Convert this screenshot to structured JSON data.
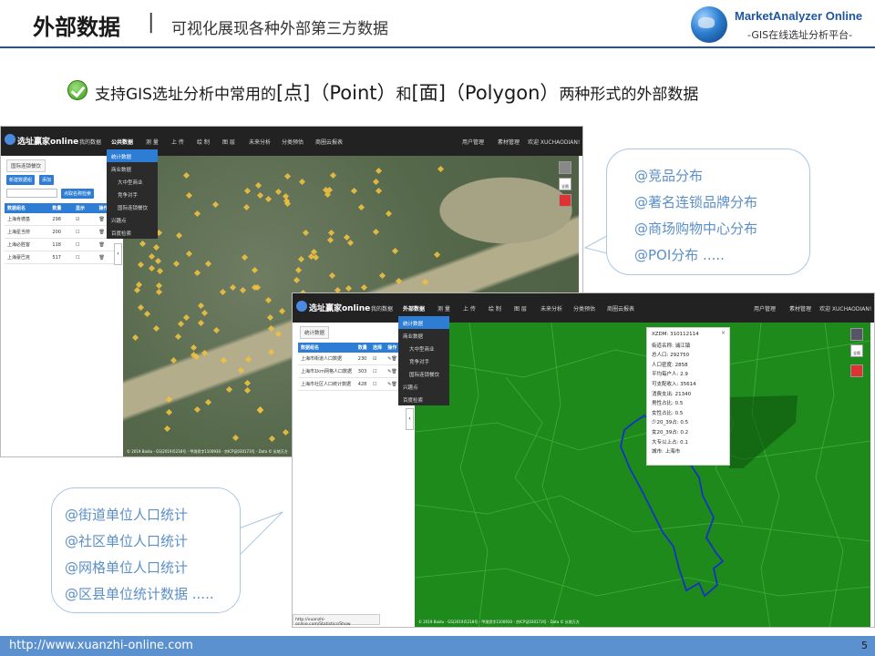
{
  "header": {
    "title": "外部数据",
    "separator": "|",
    "subtitle": "可视化展现各种外部第三方数据",
    "logo_name": "MarketAnalyzer Online",
    "logo_tagline": "-GIS在线选址分析平台-"
  },
  "lead": {
    "icon": "check-icon",
    "part1": "支持GIS选址分析中常用的",
    "point_cn": "[点]",
    "point_en": "（Point）",
    "and": "和",
    "polygon_cn": "[面]",
    "polygon_en": "（Polygon）",
    "part2": "两种形式的外部数据"
  },
  "app1": {
    "brand": "选址赢家online",
    "menu": [
      "我的数据",
      "公共数据",
      "测 量",
      "上 传",
      "绘 制",
      "图 层",
      "未来分析",
      "分类预估",
      "商圈云报表"
    ],
    "active_menu": "公共数据",
    "right_menu": [
      "用户管理",
      "素材管理",
      "欢迎 XUCHAODIAN!"
    ],
    "dropdown": [
      "统计数据",
      "商业数据",
      "大中型商业",
      "竞争对手",
      "国际连锁餐饮",
      "兴趣点",
      "百度检索"
    ],
    "tab": "国际连锁餐饮",
    "buttons": [
      "新建数据组",
      "添加"
    ],
    "search_button": "点取名称检索",
    "table_headers": [
      "数据组名",
      "数量",
      "显示",
      "操作"
    ],
    "rows": [
      {
        "name": "上海肯德基",
        "count": "298"
      },
      {
        "name": "上海星当劳",
        "count": "200"
      },
      {
        "name": "上海必胜客",
        "count": "118"
      },
      {
        "name": "上海豪巴克",
        "count": "517"
      }
    ],
    "map_note": "© 2019 Baidu - GS(2019)5218号 - 甲测资字1100930 - 京ICP证030173号 - Data © 长地万方",
    "map_controls": [
      "layers-icon",
      "locate-icon",
      "poi-icon"
    ],
    "map_ctrl_label": "全图"
  },
  "app2": {
    "brand": "选址赢家online",
    "menu": [
      "我的数据",
      "外部数据",
      "测 量",
      "上 传",
      "绘 制",
      "图 层",
      "未来分析",
      "分类预估",
      "商圈云报表"
    ],
    "active_menu": "外部数据",
    "right_menu": [
      "用户管理",
      "素材管理",
      "欢迎 XUCHAODIAN!"
    ],
    "dropdown": [
      "统计数据",
      "商业数据",
      "大中型商业",
      "竞争对手",
      "国际连锁餐饮",
      "兴趣点",
      "百度检索"
    ],
    "tab": "统计数据",
    "table_headers": [
      "数据组名",
      "数量",
      "选择",
      "操作"
    ],
    "rows": [
      {
        "name": "上海市街道人口数据",
        "count": "230"
      },
      {
        "name": "上海市1km网格人口数据",
        "count": "303"
      },
      {
        "name": "上海市社区人口统计数据",
        "count": "428"
      }
    ],
    "status_url": "http://xuanzhi-online.com/Statistics/Show",
    "map_note": "© 2019 Baidu - GS(2019)5218号 - 甲测资字1100930 - 京ICP证030173号 - Data © 长地万方",
    "map_ctrl_label": "全图",
    "popup": {
      "close": "×",
      "lines": [
        "XZDM: 310112114",
        "街道名称: 浦江镇",
        "总人口: 292750",
        "人口密度: 2858",
        "平均每户人: 2.9",
        "可支配收入: 35614",
        "消费支出: 21340",
        "男性占比: 0.5",
        "女性占比: 0.5",
        "少20_39占: 0.5",
        "女20_39占: 0.2",
        "大专以上占: 0.1",
        "城市: 上海市"
      ]
    }
  },
  "bubble_right": [
    "@竞品分布",
    "@著名连锁品牌分布",
    "@商场购物中心分布",
    "@POI分布   ....."
  ],
  "bubble_left": [
    "@街道单位人口统计",
    "@社区单位人口统计",
    "@网格单位人口统计",
    "@区县单位统计数据   ....."
  ],
  "footer": {
    "url": "http://www.xuanzhi-online.com",
    "page": "5"
  },
  "colors": {
    "accent": "#1e56a0",
    "footer_bar": "#5b91cf",
    "bubble_text": "#5b8fc7",
    "nav_bg": "#222222",
    "map_green": "#1e8a1c",
    "marker": "#f0c040"
  }
}
